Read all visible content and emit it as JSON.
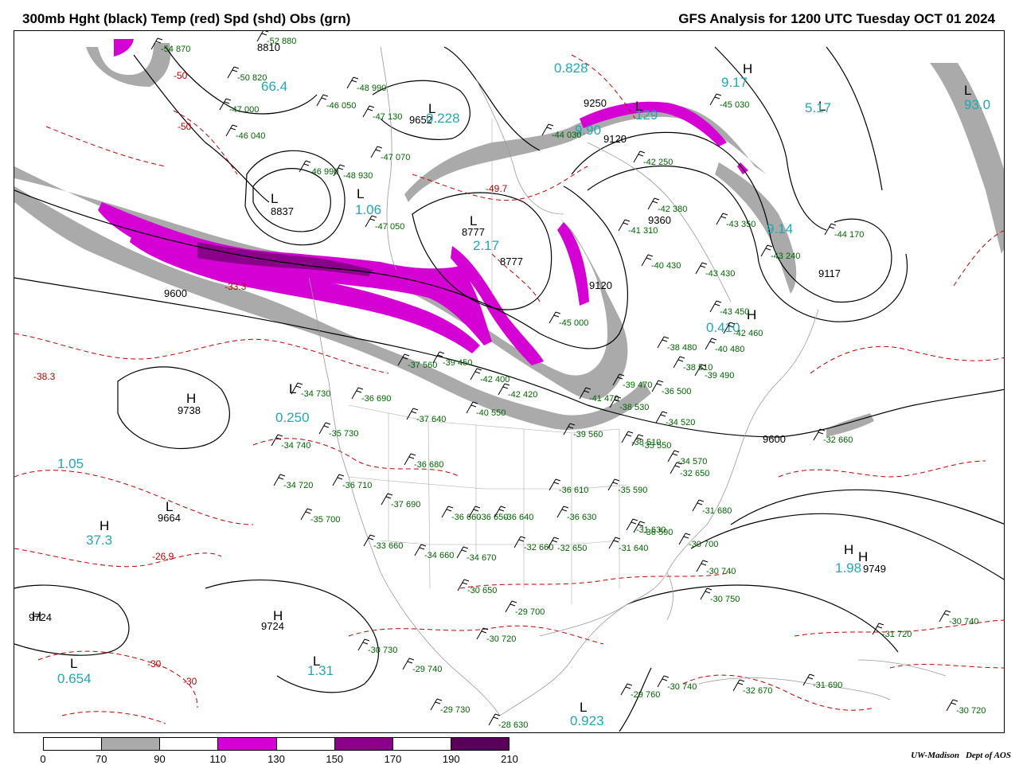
{
  "title_left": "300mb Hght (black) Temp (red) Spd (shd) Obs (grn)",
  "title_right": "GFS Analysis for 1200 UTC Tuesday OCT 01 2024",
  "colors": {
    "gray": "#aaaaaa",
    "magenta": "#d400d4",
    "purple": "#8a008a",
    "dark_purple": "#5a005a",
    "cyan": "#21a8b3",
    "temp_red": "#c00000",
    "obs_green": "#006400"
  },
  "legend": {
    "ticks": [
      "0",
      "70",
      "90",
      "110",
      "130",
      "150",
      "170",
      "190",
      "210"
    ],
    "colors": [
      "#ffffff",
      "#aaaaaa",
      "#ffffff",
      "#d400d4",
      "#ffffff",
      "#8a008a",
      "#ffffff",
      "#5a005a"
    ]
  },
  "credit": {
    "org": "UW-Madison",
    "dept": "Dept of AOS"
  },
  "height_labels": [
    "9600",
    "9600",
    "9738",
    "9664",
    "9724",
    "9724",
    "8837",
    "8777",
    "8777",
    "9120",
    "9360",
    "9120",
    "9117",
    "9749",
    "9652",
    "9250",
    "8810"
  ],
  "center_marks": [
    "H",
    "H",
    "H",
    "H",
    "L",
    "L",
    "L",
    "L",
    "L",
    "L",
    "L",
    "L",
    "H",
    "L",
    "L",
    "H",
    "H",
    "L",
    "H",
    "L"
  ],
  "cyan_values": [
    "1.05",
    "37.3",
    "0.654",
    "1.31",
    "0.250",
    "1.06",
    "2.17",
    "0.228",
    "0.828",
    "9.17",
    "5.17",
    "93.0",
    "129",
    "0.410",
    "1.98",
    "0.923",
    "9.90",
    "66.4",
    "9.14"
  ],
  "temp_labels": [
    "-38.3",
    "-26.9",
    "-30",
    "-30",
    "-49.7",
    "-33.3",
    "-50",
    "-50"
  ],
  "obs_labels": [
    "-34 730",
    "-36 690",
    "-37 560",
    "-39 450",
    "-40 550",
    "-37 640",
    "-35 730",
    "-34 740",
    "-34 720",
    "-36 710",
    "-37 690",
    "-35 700",
    "-36 680",
    "-36 660",
    "-36 650",
    "-36 640",
    "-36 630",
    "-36 610",
    "-33 660",
    "-34 660",
    "-34 670",
    "-32 660",
    "-32 650",
    "-30 650",
    "-29 700",
    "-30 720",
    "-30 730",
    "-29 740",
    "-29 730",
    "-28 630",
    "-29 760",
    "-30 740",
    "-32 670",
    "-31 690",
    "-30 740",
    "-31 720",
    "-30 720",
    "-31 680",
    "-30 700",
    "-30 740",
    "-30 750",
    "-32 660",
    "-32 650",
    "-34 570",
    "-35 550",
    "-34 520",
    "-36 500",
    "-38 510",
    "-39 470",
    "-41 470",
    "-42 420",
    "-42 400",
    "-39 490",
    "-38 480",
    "-40 480",
    "-43 450",
    "-40 430",
    "-41 310",
    "-42 250",
    "-42 380",
    "-43 350",
    "-44 170",
    "-45 030",
    "-43 430",
    "-47 070",
    "-47 130",
    "-48 990",
    "-46 050",
    "-46 040",
    "-47 000",
    "-50 820",
    "-54 870",
    "-52 880",
    "-46 990",
    "-48 930",
    "-47 050",
    "-43 240",
    "-45 000",
    "-44 030",
    "-42 460",
    "-38 530",
    "-38 510",
    "-35 590",
    "-39 560",
    "-36 590",
    "-31 630",
    "-31 640",
    "-33 610"
  ]
}
